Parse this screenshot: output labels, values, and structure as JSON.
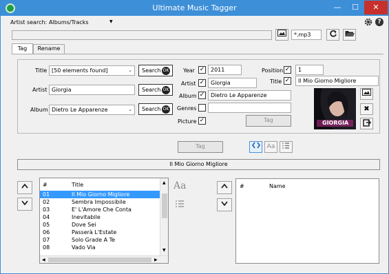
{
  "window": {
    "title": "Ultimate Music Tagger",
    "minimize_glyph": "—",
    "maximize_glyph": "☐",
    "close_glyph": "✕"
  },
  "toolbar": {
    "artist_search_label": "Artist search:",
    "artist_search_value": "Albums/Tracks",
    "settings_icon": "gear-icon",
    "help_icon": "help-icon"
  },
  "path_bar": {
    "path_value": "",
    "filter_value": "*.mp3"
  },
  "tabs": [
    {
      "label": "Tag"
    },
    {
      "label": "Rename"
    }
  ],
  "search": {
    "title_label": "Title",
    "title_value": "[50 elements found]",
    "artist_label": "Artist",
    "artist_value": "Giorgia",
    "album_label": "Album",
    "album_value": "Dietro Le Apparenze",
    "search_label": "Search",
    "ok_glyph": "OK"
  },
  "tag": {
    "year_label": "Year",
    "year_value": "2011",
    "artist_label": "Artist",
    "artist_value": "Giorgia",
    "album_label": "Album",
    "album_value": "Dietro Le Apparenze",
    "genres_label": "Genres",
    "genres_value": "",
    "picture_label": "Picture",
    "position_label": "Position",
    "position_value": "1",
    "title_label": "Title",
    "title_value": "Il Mio Giorno Migliore",
    "tag_button": "Tag",
    "cover_text": "GIORGIA"
  },
  "actions": {
    "tag_button": "Tag",
    "current_track": "Il Mio Giorno Migliore"
  },
  "left_list": {
    "columns": [
      "#",
      "Title"
    ],
    "rows": [
      {
        "num": "01",
        "title": "Il Mio Giorno Migliore"
      },
      {
        "num": "02",
        "title": "Sembra Impossibile"
      },
      {
        "num": "03",
        "title": "E' L'Amore Che Conta"
      },
      {
        "num": "04",
        "title": "Inevitabile"
      },
      {
        "num": "05",
        "title": "Dove Sei"
      },
      {
        "num": "06",
        "title": "Passerà L'Estate"
      },
      {
        "num": "07",
        "title": "Solo Grade A Te"
      },
      {
        "num": "08",
        "title": "Vado Via"
      }
    ],
    "selected_index": 0
  },
  "right_list": {
    "columns": [
      "#",
      "Name"
    ],
    "rows": []
  },
  "colors": {
    "titlebar": "#3d8fd8",
    "close": "#c7312b",
    "selection": "#3399ff"
  }
}
